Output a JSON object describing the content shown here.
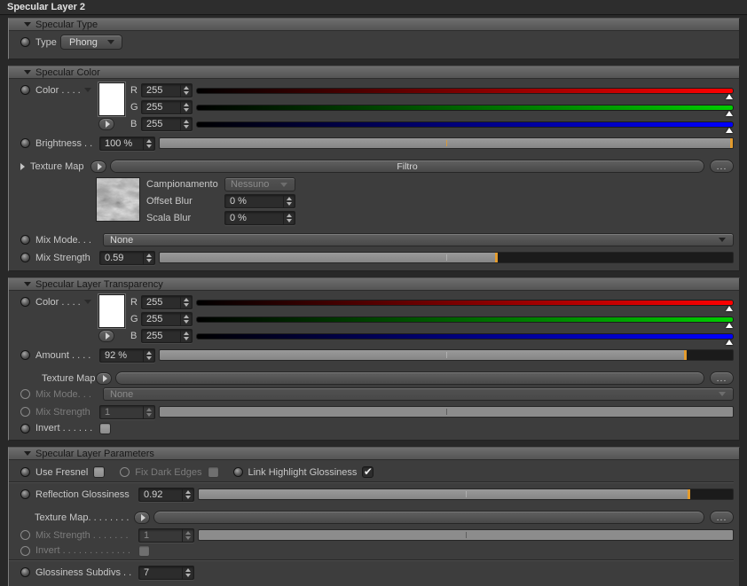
{
  "window": {
    "title": "Specular Layer 2"
  },
  "colors": {
    "accent_orange": "#e39b2d",
    "slider_red": "#ff0000",
    "slider_green": "#00cc00",
    "slider_blue": "#0000ff"
  },
  "sections": {
    "specular_type": {
      "title": "Specular Type",
      "type_label": "Type",
      "type_value": "Phong"
    },
    "specular_color": {
      "title": "Specular Color",
      "color_label": "Color . . . .",
      "rgb": [
        {
          "letter": "R",
          "value": "255"
        },
        {
          "letter": "G",
          "value": "255"
        },
        {
          "letter": "B",
          "value": "255"
        }
      ],
      "brightness_label": "Brightness . .",
      "brightness_value": "100 %",
      "brightness_percent": 100,
      "texture_label": "Texture Map",
      "filter_button": "Filtro",
      "more_button": "...",
      "sampling_label": "Campionamento",
      "sampling_value": "Nessuno",
      "offset_blur_label": "Offset Blur",
      "offset_blur_value": "0 %",
      "scale_blur_label": "Scala Blur",
      "scale_blur_value": "0 %",
      "mix_mode_label": "Mix Mode. . .",
      "mix_mode_value": "None",
      "mix_strength_label": "Mix Strength",
      "mix_strength_value": "0.59",
      "mix_strength_percent": 59
    },
    "transparency": {
      "title": "Specular Layer Transparency",
      "color_label": "Color . . . .",
      "rgb": [
        {
          "letter": "R",
          "value": "255"
        },
        {
          "letter": "G",
          "value": "255"
        },
        {
          "letter": "B",
          "value": "255"
        }
      ],
      "amount_label": "Amount . . . .",
      "amount_value": "92 %",
      "amount_percent": 92,
      "texture_label": "Texture Map",
      "more_button": "...",
      "mix_mode_label": "Mix Mode. . .",
      "mix_mode_value": "None",
      "mix_strength_label": "Mix Strength",
      "mix_strength_value": "1",
      "mix_strength_percent": 100,
      "invert_label": "Invert . . . . . ."
    },
    "parameters": {
      "title": "Specular Layer Parameters",
      "use_fresnel_label": "Use Fresnel",
      "fix_dark_edges_label": "Fix Dark Edges",
      "link_highlight_label": "Link Highlight Glossiness",
      "link_highlight_check": "✔",
      "reflection_glossiness_label": "Reflection Glossiness",
      "reflection_glossiness_value": "0.92",
      "reflection_glossiness_percent": 92,
      "texture_label": "Texture Map. . . . . . . .",
      "more_button": "...",
      "mix_strength_label": "Mix Strength . . . . . . .",
      "mix_strength_value": "1",
      "mix_strength_percent": 100,
      "invert_label": "Invert . . . . . . . . . . . . .",
      "glossiness_subdivs_label": "Glossiness Subdivs . .",
      "glossiness_subdivs_value": "7"
    }
  }
}
